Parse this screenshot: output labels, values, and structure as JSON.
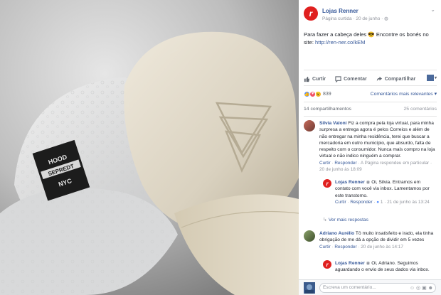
{
  "post": {
    "page_name": "Lojas Renner",
    "logo_letter": "r",
    "meta_prefix": "Página curtida · ",
    "meta_date": "20 de junho",
    "meta_suffix": " · ",
    "text_before": "Para fazer a cabeça deles 😎 Encontre os bonés no site: ",
    "link": "http://ren-ner.co/kEM",
    "chevron": "⌄"
  },
  "photo": {
    "patch_line1": "HOOD",
    "patch_line2": "SEPREDT",
    "patch_line3": "NYC"
  },
  "actions": {
    "like": "Curtir",
    "comment": "Comentar",
    "share": "Compartilhar",
    "share_caret": "▾"
  },
  "reactions": {
    "count": "839",
    "relevance": "Comentários mais relevantes ▾"
  },
  "stats": {
    "shares": "14 compartilhamentos",
    "comments": "25 comentários"
  },
  "comments": [
    {
      "name": "Silvia Valoni",
      "text": " Fiz a compra pela loja virtual, para minha surpresa a entrega agora é pelos Correios e além de não entregar na minha residência, terei que buscar a mercadoria em outro município, que absurdo, falta de respeito com o consumidor. Nunca mais compro na loja virtual e não indico ninguém a comprar.",
      "like": "Curtir",
      "reply": "Responder",
      "footer": " · A Página respondeu em particular · 20 de junho às 18:09"
    },
    {
      "name": "Lojas Renner",
      "text": " Oi, Silvia. Entramos em contato com você via inbox. Lamentamos por este transtorno.",
      "like": "Curtir",
      "reply": "Responder",
      "count": " 1",
      "footer": " · 21 de junho às 13:24"
    },
    {
      "name": "Adriano Aurélio",
      "text": " Tô muito insatisfeito e irado, ela tinha obrigação de me dá a opção de dividir em 5 vezes",
      "like": "Curtir",
      "reply": "Responder",
      "footer": " · 20 de junho às 14:17"
    },
    {
      "name": "Lojas Renner",
      "text": " Oi, Adriano. Seguimos aguardando o envio de seus dados via inbox."
    }
  ],
  "more_replies": "Ver mais respostas",
  "composer": {
    "placeholder": "Escreva um comentário...",
    "icons": "☺ ◎ ▣ ☻"
  },
  "colors": {
    "link": "#365899",
    "brand_red": "#e0201f",
    "muted": "#90949c"
  }
}
